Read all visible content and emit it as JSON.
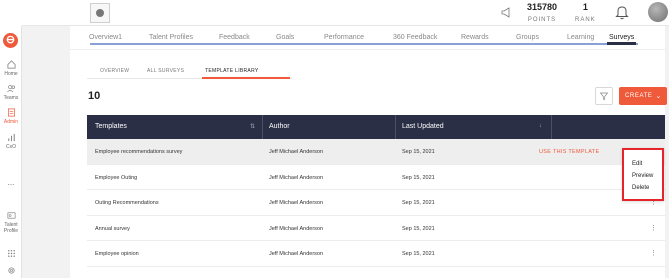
{
  "header": {
    "points_value": "315780",
    "points_label": "POINTS",
    "rank_value": "1",
    "rank_label": "RANK"
  },
  "sidebar": {
    "items": [
      {
        "label": "Home"
      },
      {
        "label": "Teams"
      },
      {
        "label": "Admin"
      },
      {
        "label": "CxO"
      },
      {
        "label": "..."
      },
      {
        "label": "Talent Profile"
      }
    ]
  },
  "nav": {
    "tabs": [
      {
        "label": "Overview1"
      },
      {
        "label": "Talent Profiles"
      },
      {
        "label": "Feedback"
      },
      {
        "label": "Goals"
      },
      {
        "label": "Performance"
      },
      {
        "label": "360 Feedback"
      },
      {
        "label": "Rewards"
      },
      {
        "label": "Groups"
      },
      {
        "label": "Learning"
      },
      {
        "label": "Surveys"
      }
    ]
  },
  "subtabs": [
    {
      "label": "OVERVIEW"
    },
    {
      "label": "ALL SURVEYS"
    },
    {
      "label": "TEMPLATE LIBRARY"
    }
  ],
  "toolbar": {
    "count": "10",
    "create_label": "CREATE"
  },
  "table": {
    "columns": [
      "Templates",
      "Author",
      "Last Updated"
    ],
    "rows": [
      {
        "template": "Employee recommendations survey",
        "author": "Jeff Michael Anderson",
        "updated": "Sep 15, 2021"
      },
      {
        "template": "Employee Outing",
        "author": "Jeff Michael Anderson",
        "updated": "Sep 15, 2021"
      },
      {
        "template": "Outing Recommendations",
        "author": "Jeff Michael Anderson",
        "updated": "Sep 15, 2021"
      },
      {
        "template": "Annual survey",
        "author": "Jeff Michael Anderson",
        "updated": "Sep 15, 2021"
      },
      {
        "template": "Employee opinion",
        "author": "Jeff Michael Anderson",
        "updated": "Sep 15, 2021"
      }
    ],
    "use_template_label": "USE THIS TEMPLATE"
  },
  "context_menu": {
    "items": [
      {
        "label": "Edit"
      },
      {
        "label": "Preview"
      },
      {
        "label": "Delete"
      }
    ]
  },
  "colors": {
    "accent": "#ef5a3a",
    "header_bg": "#2a2f45",
    "highlight_border": "#e5252a"
  }
}
